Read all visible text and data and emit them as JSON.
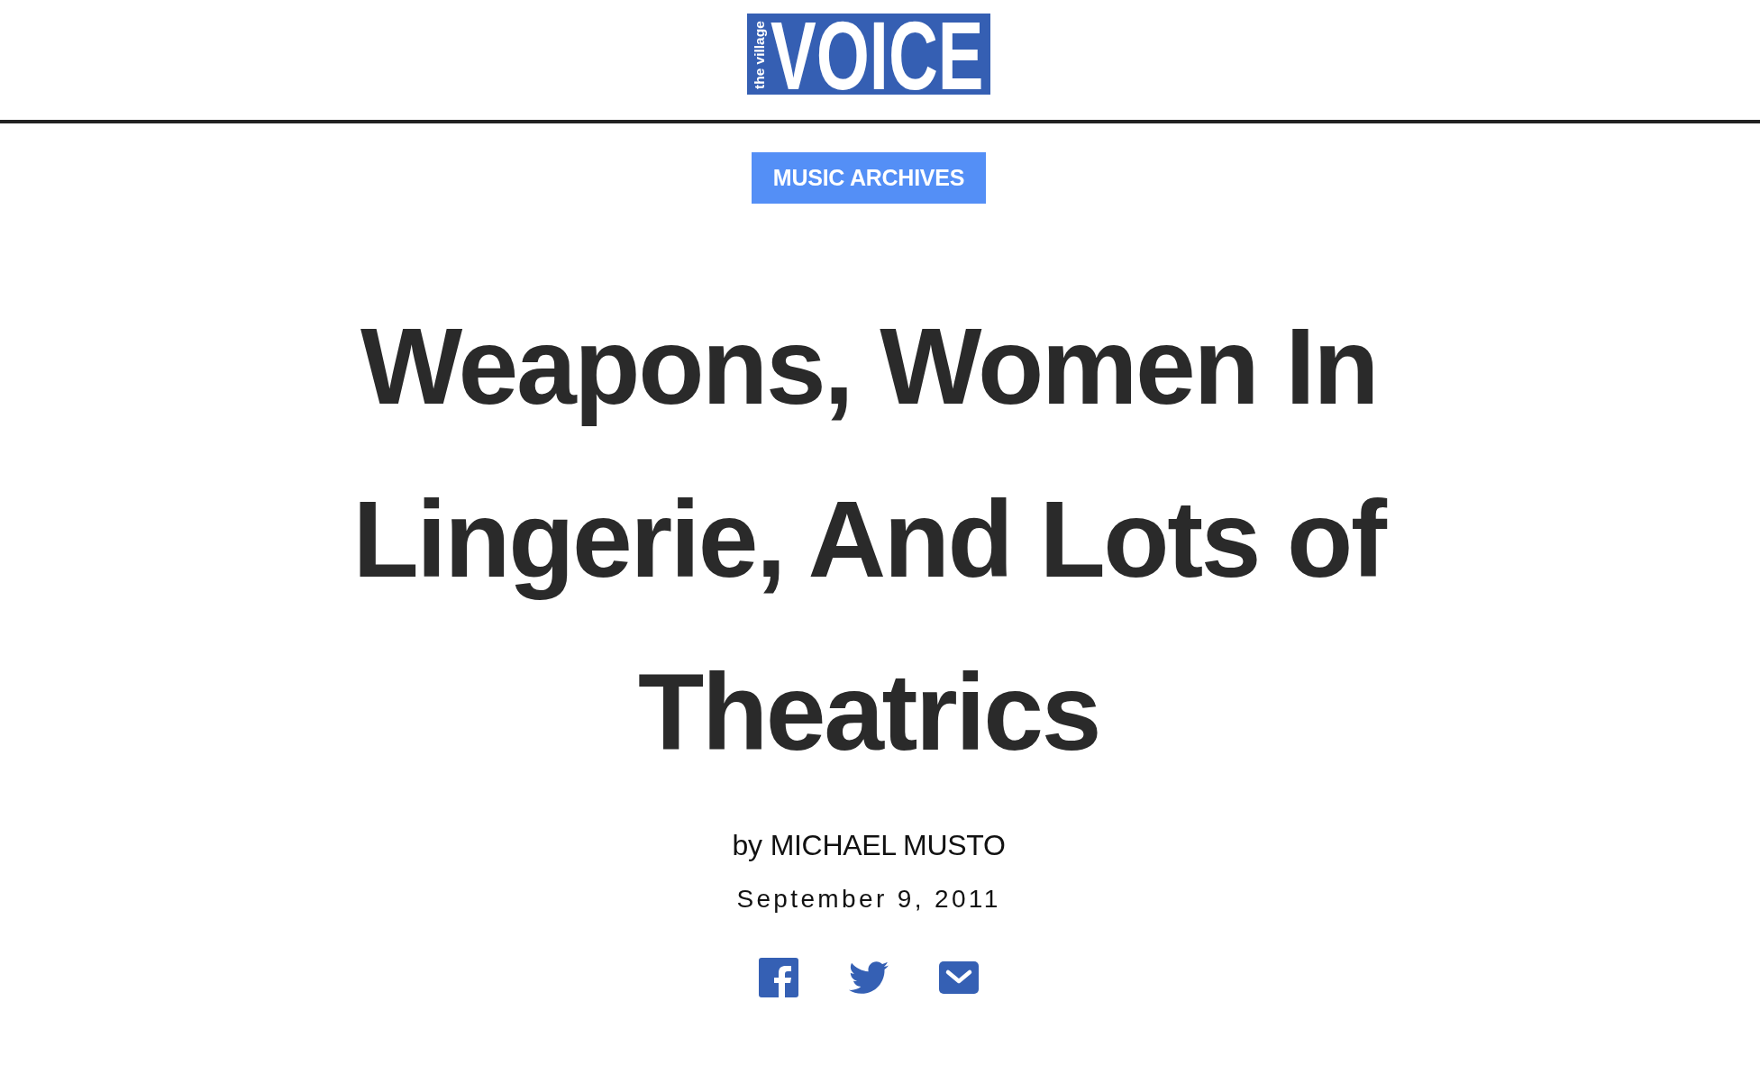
{
  "header": {
    "logo": {
      "tagline": "the village",
      "wordmark": "VOICE"
    }
  },
  "article": {
    "category": "MUSIC ARCHIVES",
    "title": "Weapons, Women In Lingerie, And Lots of Theatrics",
    "byline": {
      "prefix": "by",
      "author": "MICHAEL MUSTO"
    },
    "date": "September 9, 2011",
    "share_links": [
      {
        "kind": "facebook"
      },
      {
        "kind": "twitter"
      },
      {
        "kind": "email"
      }
    ]
  }
}
